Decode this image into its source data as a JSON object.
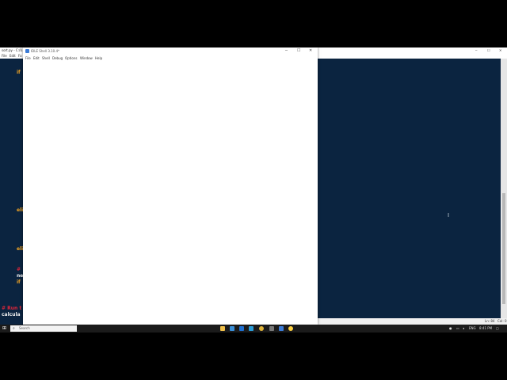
{
  "editor": {
    "title": "sort.py - C:/U...",
    "menu": [
      "File",
      "Edit",
      "Fo"
    ],
    "code_fragments": [
      {
        "text": "if",
        "cls": "kw"
      },
      {
        "text": "eli",
        "cls": "kw"
      },
      {
        "text": "eli",
        "cls": "kw"
      },
      {
        "text": "#",
        "cls": "cm"
      },
      {
        "text": "ne",
        "cls": "wh"
      },
      {
        "text": "if",
        "cls": "kw"
      },
      {
        "text": "# Run t",
        "cls": "cm"
      },
      {
        "text": "calcula",
        "cls": "wh"
      }
    ],
    "status": {
      "line": "Ln: 84",
      "col": "Col: 0"
    },
    "window_controls": {
      "minimize": "─",
      "maximize": "☐",
      "close": "✕"
    }
  },
  "shell": {
    "title": "IDLE Shell 3.10.4*",
    "menu": [
      "File",
      "Edit",
      "Shell",
      "Debug",
      "Options",
      "Window",
      "Help"
    ],
    "window_controls": {
      "minimize": "─",
      "maximize": "☐",
      "close": "✕"
    }
  },
  "taskbar": {
    "search_placeholder": "Search",
    "time": "8:41 PM",
    "lang": "ENG"
  }
}
